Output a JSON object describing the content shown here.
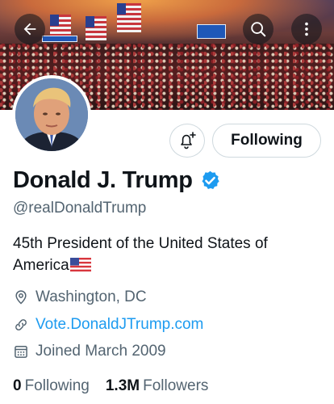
{
  "profile": {
    "name": "Donald J. Trump",
    "handle": "@realDonaldTrump",
    "bio": "45th President of the United States of America",
    "location": "Washington, DC",
    "website": "Vote.DonaldJTrump.com",
    "joined": "Joined March 2009",
    "verified": true
  },
  "actions": {
    "follow_label": "Following"
  },
  "stats": {
    "following_count": "0",
    "following_label": "Following",
    "followers_count": "1.3M",
    "followers_label": "Followers"
  },
  "icons": {
    "back": "arrow-left-icon",
    "search": "search-icon",
    "more": "more-vertical-icon",
    "notify": "bell-plus-icon",
    "verified": "verified-badge-icon",
    "location": "location-pin-icon",
    "link": "link-icon",
    "calendar": "calendar-icon",
    "bio_flag": "us-flag-icon"
  },
  "colors": {
    "accent": "#1d9bf0",
    "text_primary": "#0f1419",
    "text_secondary": "#536471",
    "border": "#cfd9de"
  }
}
